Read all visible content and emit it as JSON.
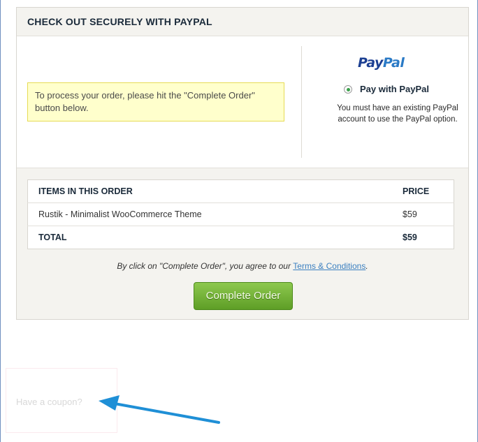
{
  "checkout": {
    "title": "CHECK OUT SECURELY WITH PAYPAL",
    "notice": "To process your order, please hit the \"Complete Order\" button below."
  },
  "paypal": {
    "logo_pay": "Pay",
    "logo_pal": "Pal",
    "option_label": "Pay with PayPal",
    "option_selected": true,
    "description": "You must have an existing PayPal account to use the PayPal option."
  },
  "order": {
    "header": {
      "item": "ITEMS IN THIS ORDER",
      "price": "PRICE"
    },
    "items": [
      {
        "name": "Rustik - Minimalist WooCommerce Theme",
        "price": "$59"
      }
    ],
    "total": {
      "label": "TOTAL",
      "value": "$59"
    }
  },
  "agreement": {
    "text": "By click on \"Complete Order\", you agree to our ",
    "link": "Terms & Conditions",
    "suffix": "."
  },
  "complete_button": "Complete Order",
  "coupon": {
    "text": "Have a coupon?"
  },
  "colors": {
    "accent_green": "#6fb036",
    "notice_bg": "#ffffcc",
    "link_blue": "#3a7fc0",
    "annotation_arrow": "#1f8fd6"
  }
}
